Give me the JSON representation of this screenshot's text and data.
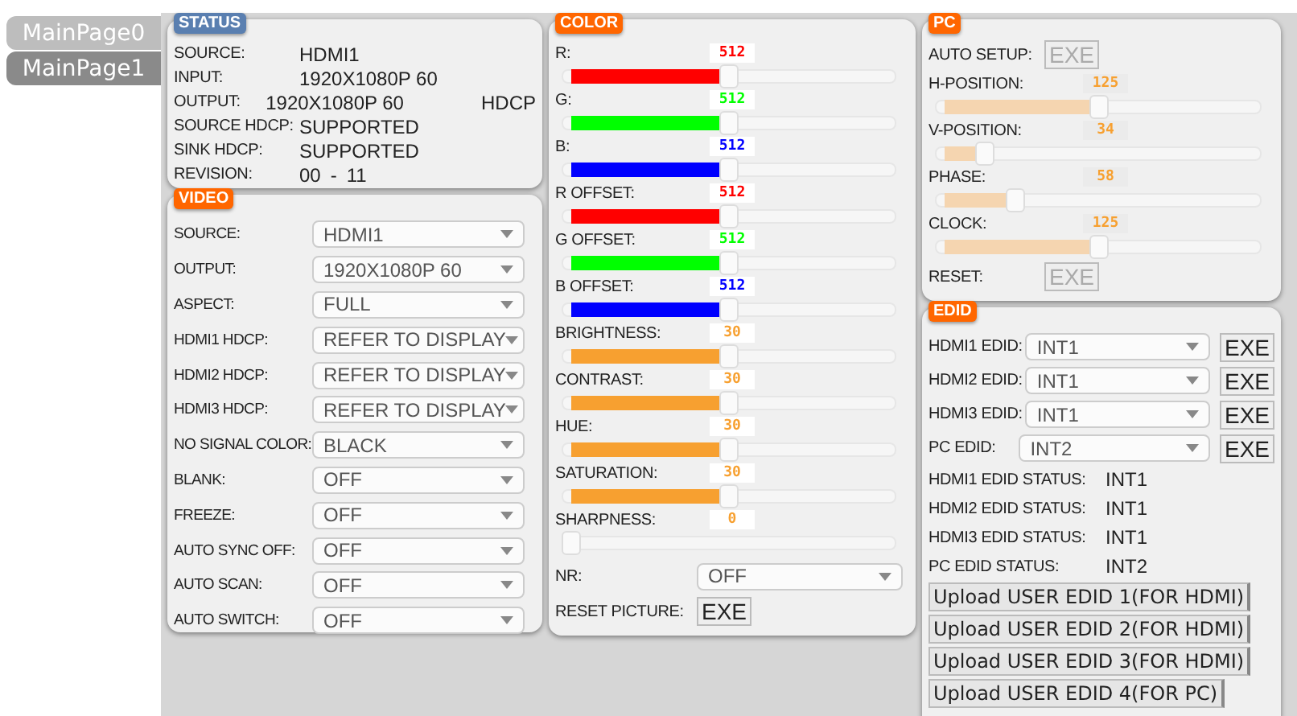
{
  "tabs": [
    {
      "label": "MainPage0",
      "selected": false
    },
    {
      "label": "MainPage1",
      "selected": true
    }
  ],
  "status": {
    "title": "STATUS",
    "rows": [
      {
        "label": "SOURCE:",
        "values": [
          "HDMI1"
        ]
      },
      {
        "label": "INPUT:",
        "values": [
          "1920X1080P 60"
        ]
      },
      {
        "label": "OUTPUT:",
        "values": [
          "1920X1080P 60",
          "HDCP"
        ]
      },
      {
        "label": "SOURCE HDCP:",
        "values": [
          "SUPPORTED"
        ]
      },
      {
        "label": "SINK HDCP:",
        "values": [
          "SUPPORTED"
        ]
      },
      {
        "label": "REVISION:",
        "values": [
          "00",
          "-",
          "11"
        ]
      }
    ]
  },
  "video": {
    "title": "VIDEO",
    "rows": [
      {
        "label": "SOURCE:",
        "value": "HDMI1"
      },
      {
        "label": "OUTPUT:",
        "value": "1920X1080P 60"
      },
      {
        "label": "ASPECT:",
        "value": "FULL"
      },
      {
        "label": "HDMI1 HDCP:",
        "value": "REFER TO DISPLAY"
      },
      {
        "label": "HDMI2 HDCP:",
        "value": "REFER TO DISPLAY"
      },
      {
        "label": "HDMI3 HDCP:",
        "value": "REFER TO DISPLAY"
      },
      {
        "label": "NO SIGNAL COLOR:",
        "value": "BLACK"
      },
      {
        "label": "BLANK:",
        "value": "OFF"
      },
      {
        "label": "FREEZE:",
        "value": "OFF"
      },
      {
        "label": "AUTO SYNC OFF:",
        "value": "OFF"
      },
      {
        "label": "AUTO SCAN:",
        "value": "OFF"
      },
      {
        "label": "AUTO SWITCH:",
        "value": "OFF"
      }
    ]
  },
  "color": {
    "title": "COLOR",
    "sliders": [
      {
        "label": "R:",
        "reading": "512",
        "level": 0.5,
        "color": "#ff0000"
      },
      {
        "label": "G:",
        "reading": "512",
        "level": 0.5,
        "color": "#00ff00"
      },
      {
        "label": "B:",
        "reading": "512",
        "level": 0.5,
        "color": "#0000ff"
      },
      {
        "label": "R OFFSET:",
        "reading": "512",
        "level": 0.5,
        "color": "#ff0000"
      },
      {
        "label": "G OFFSET:",
        "reading": "512",
        "level": 0.5,
        "color": "#00ff00"
      },
      {
        "label": "B OFFSET:",
        "reading": "512",
        "level": 0.5,
        "color": "#0000ff"
      },
      {
        "label": "BRIGHTNESS:",
        "reading": "30",
        "level": 0.5,
        "color": "#f7a030"
      },
      {
        "label": "CONTRAST:",
        "reading": "30",
        "level": 0.5,
        "color": "#f7a030"
      },
      {
        "label": "HUE:",
        "reading": "30",
        "level": 0.5,
        "color": "#f7a030"
      },
      {
        "label": "SATURATION:",
        "reading": "30",
        "level": 0.5,
        "color": "#f7a030"
      },
      {
        "label": "SHARPNESS:",
        "reading": "0",
        "level": 0,
        "color": "#f7a030"
      }
    ],
    "nr": {
      "label": "NR:",
      "value": "OFF"
    },
    "reset": {
      "label": "RESET PICTURE:",
      "button": "EXE",
      "disabled": false
    }
  },
  "pc": {
    "title": "PC",
    "auto_setup": {
      "label": "AUTO SETUP:",
      "button": "EXE",
      "disabled": true
    },
    "sliders": [
      {
        "label": "H-POSITION:",
        "reading": "125",
        "level": 0.5
      },
      {
        "label": "V-POSITION:",
        "reading": "34",
        "level": 0.13
      },
      {
        "label": "PHASE:",
        "reading": "58",
        "level": 0.23
      },
      {
        "label": "CLOCK:",
        "reading": "125",
        "level": 0.5
      }
    ],
    "reset": {
      "label": "RESET:",
      "button": "EXE",
      "disabled": true
    }
  },
  "edid": {
    "title": "EDID",
    "selects": [
      {
        "label": "HDMI1 EDID:",
        "value": "INT1",
        "button": "EXE"
      },
      {
        "label": "HDMI2 EDID:",
        "value": "INT1",
        "button": "EXE"
      },
      {
        "label": "HDMI3 EDID:",
        "value": "INT1",
        "button": "EXE"
      },
      {
        "label": "PC EDID:",
        "value": "INT2",
        "button": "EXE"
      }
    ],
    "statuses": [
      {
        "label": "HDMI1 EDID STATUS:",
        "value": "INT1"
      },
      {
        "label": "HDMI2 EDID STATUS:",
        "value": "INT1"
      },
      {
        "label": "HDMI3 EDID STATUS:",
        "value": "INT1"
      },
      {
        "label": "PC EDID STATUS:",
        "value": "INT2"
      }
    ],
    "uploads": [
      "Upload USER EDID 1(FOR HDMI)",
      "Upload USER EDID 2(FOR HDMI)",
      "Upload USER EDID 3(FOR HDMI)",
      "Upload USER EDID 4(FOR PC)"
    ]
  }
}
